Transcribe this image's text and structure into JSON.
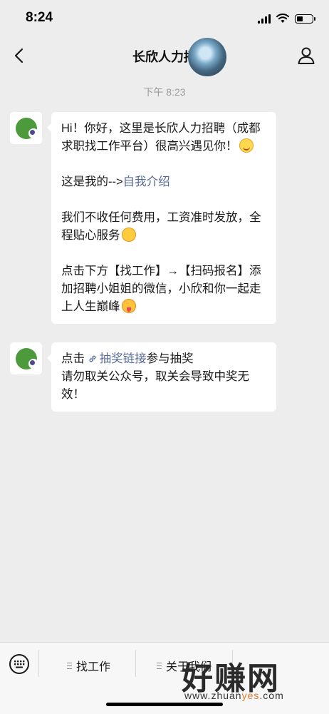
{
  "status_bar": {
    "time": "8:24"
  },
  "nav": {
    "title": "长欣人力招"
  },
  "chat": {
    "timestamp": "下午 8:23",
    "message1": {
      "para1": "Hi！你好，这里是长欣人力招聘（成都求职找工作平台）很高兴遇见你！",
      "para2_prefix": "这是我的-->",
      "para2_link": "自我介绍",
      "para3": "我们不收任何费用，工资准时发放，全程贴心服务",
      "para4": "点击下方【找工作】→【扫码报名】添加招聘小姐姐的微信，小欣和你一起走上人生巅峰"
    },
    "message2": {
      "prefix": "点击",
      "link": "抽奖链接",
      "suffix": "参与抽奖",
      "line2": "请勿取关公众号，取关会导致中奖无效！"
    }
  },
  "bottom_menu": {
    "item1": "找工作",
    "item2": "关于我们"
  },
  "watermark": {
    "main": "好赚网",
    "sub_prefix": "www.zhuan",
    "sub_highlight": "yes",
    "sub_suffix": ".com"
  }
}
